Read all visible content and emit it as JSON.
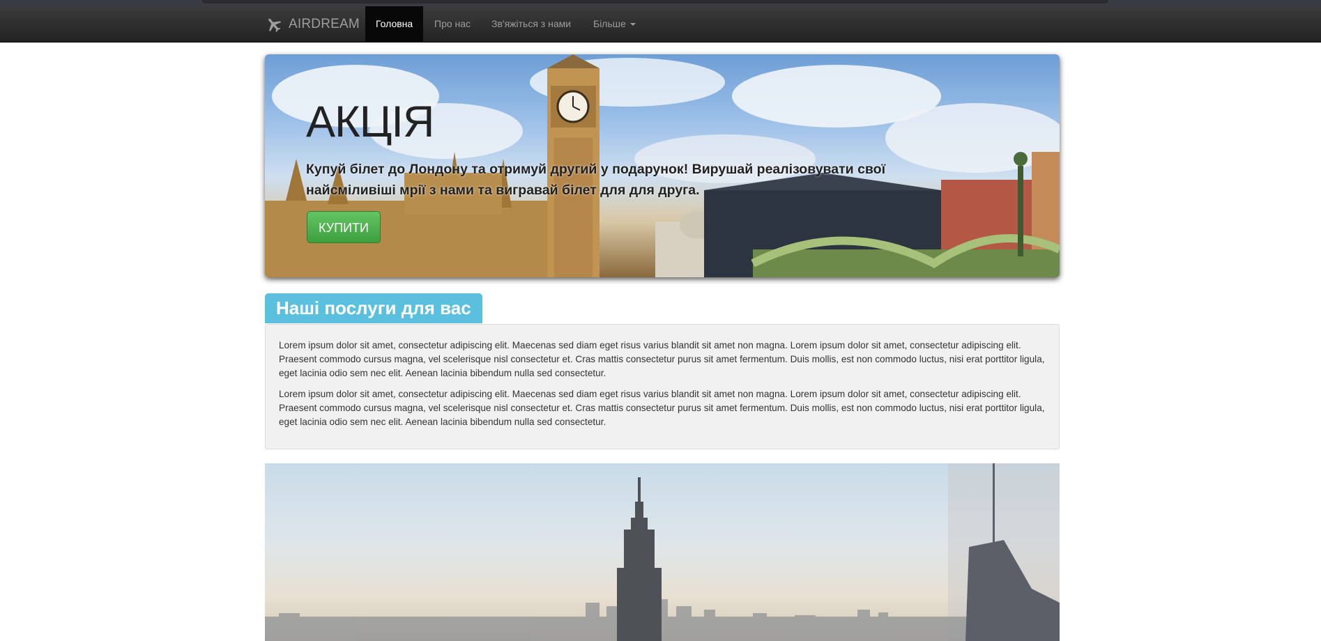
{
  "navbar": {
    "brand": "AIRDREAM",
    "items": [
      {
        "label": "Головна",
        "active": true
      },
      {
        "label": "Про нас",
        "active": false
      },
      {
        "label": "Зв'яжіться з нами",
        "active": false
      },
      {
        "label": "Більше",
        "active": false,
        "dropdown": true
      }
    ]
  },
  "hero": {
    "title": "АКЦІЯ",
    "text": "Купуй білет до Лондону та отримуй другий у подарунок! Вирушай реалізовувати свої найсміливіші мрії з нами та вигравай білет для для друга.",
    "button_label": "КУПИТИ"
  },
  "services": {
    "heading": "Наші послуги для вас",
    "paragraphs": [
      "Lorem ipsum dolor sit amet, consectetur adipiscing elit. Maecenas sed diam eget risus varius blandit sit amet non magna. Lorem ipsum dolor sit amet, consectetur adipiscing elit. Praesent commodo cursus magna, vel scelerisque nisl consectetur et. Cras mattis consectetur purus sit amet fermentum. Duis mollis, est non commodo luctus, nisi erat porttitor ligula, eget lacinia odio sem nec elit. Aenean lacinia bibendum nulla sed consectetur.",
      "Lorem ipsum dolor sit amet, consectetur adipiscing elit. Maecenas sed diam eget risus varius blandit sit amet non magna. Lorem ipsum dolor sit amet, consectetur adipiscing elit. Praesent commodo cursus magna, vel scelerisque nisl consectetur et. Cras mattis consectetur purus sit amet fermentum. Duis mollis, est non commodo luctus, nisi erat porttitor ligula, eget lacinia odio sem nec elit. Aenean lacinia bibendum nulla sed consectetur."
    ]
  },
  "colors": {
    "navbar_bg": "#222222",
    "nav_text": "#9d9d9d",
    "active_bg": "#080808",
    "button_green": "#4cae4c",
    "section_label": "#5bc0de",
    "well_bg": "#f1f1f1"
  },
  "icons": {
    "brand": "airplane-icon",
    "dropdown": "caret-down-icon"
  }
}
